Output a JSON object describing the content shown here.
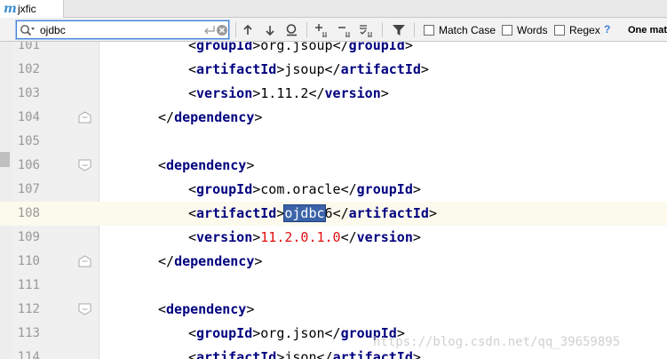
{
  "tab": {
    "icon": "maven-m-icon",
    "icon_glyph": "m",
    "label": "jxfic"
  },
  "search": {
    "value": "ojdbc",
    "options": [
      {
        "label": "Match Case",
        "checked": false
      },
      {
        "label": "Words",
        "checked": false
      },
      {
        "label": "Regex",
        "checked": false
      }
    ],
    "help": "?",
    "match_count": "One match"
  },
  "editor": {
    "current_line": "108",
    "highlight": "ojdbc",
    "lines": [
      {
        "num": "101",
        "open": "groupId",
        "text": "org.jsoup",
        "close": "groupId"
      },
      {
        "num": "102",
        "open": "artifactId",
        "text": "jsoup",
        "close": "artifactId"
      },
      {
        "num": "103",
        "open": "version",
        "text": "1.11.2",
        "close": "version"
      },
      {
        "num": "104",
        "close_only": "dependency"
      },
      {
        "num": "105"
      },
      {
        "num": "106",
        "open_only": "dependency"
      },
      {
        "num": "107",
        "open": "groupId",
        "text": "com.oracle",
        "close": "groupId"
      },
      {
        "num": "108",
        "open": "artifactId",
        "text_hl": "ojdbc",
        "text": "6",
        "close": "artifactId"
      },
      {
        "num": "109",
        "open": "version",
        "text_red": "11.2.0.1.0",
        "close": "version"
      },
      {
        "num": "110",
        "close_only": "dependency"
      },
      {
        "num": "111"
      },
      {
        "num": "112",
        "open_only": "dependency"
      },
      {
        "num": "113",
        "open": "groupId",
        "text": "org.json",
        "close": "groupId"
      },
      {
        "num": "114",
        "open": "artifactId",
        "text": "json",
        "close": "artifactId"
      }
    ]
  },
  "watermark": "https://blog.csdn.net/qq_39659895"
}
